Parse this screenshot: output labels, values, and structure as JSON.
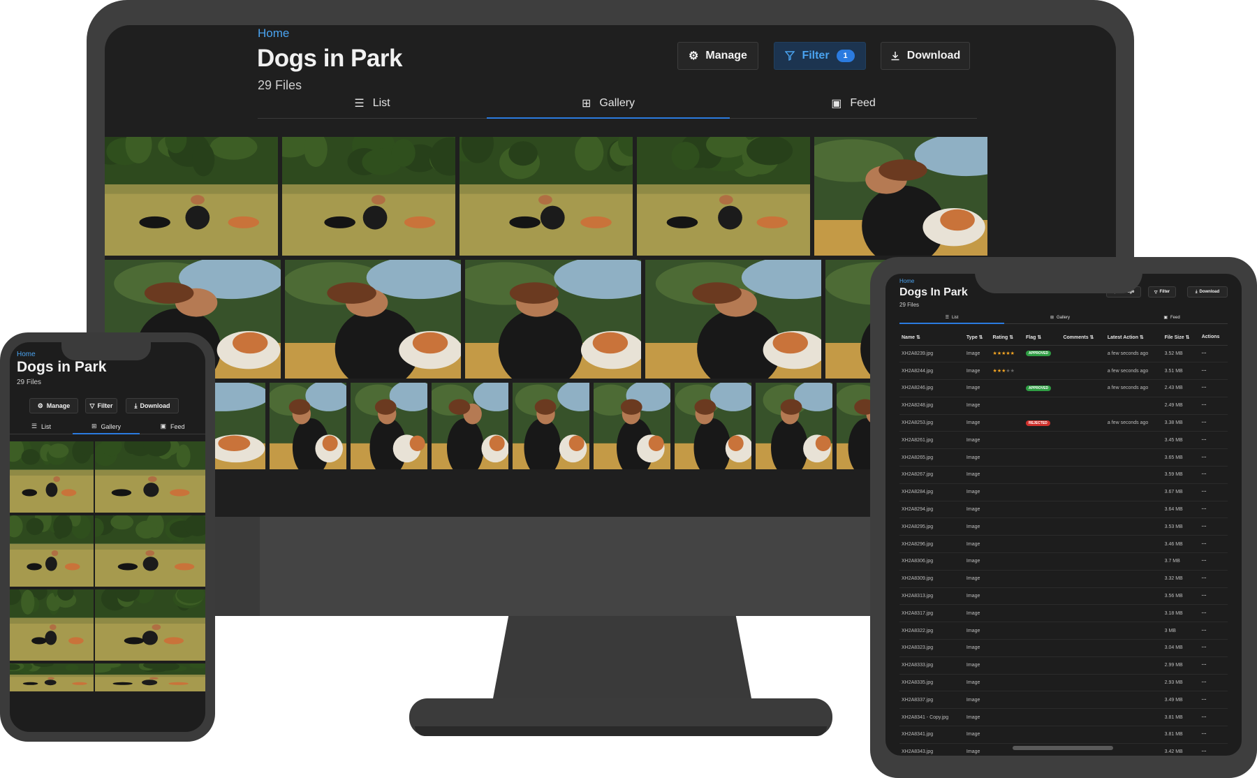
{
  "app": {
    "breadcrumb": "Home",
    "title": "Dogs in Park",
    "tablet_title": "Dogs In Park",
    "file_count": "29 Files"
  },
  "toolbar": {
    "manage_label": "Manage",
    "filter_label": "Filter",
    "filter_count": "1",
    "download_label": "Download"
  },
  "tabs": [
    {
      "label": "List",
      "icon": "list-icon",
      "active": false
    },
    {
      "label": "Gallery",
      "icon": "grid-icon",
      "active": true
    },
    {
      "label": "Feed",
      "icon": "image-icon",
      "active": false
    }
  ],
  "colors": {
    "accent": "#2b7be0",
    "link": "#4aa3f0",
    "background": "#1f1f1f",
    "approved": "#2f9e44",
    "rejected": "#d0312d",
    "star": "#f5a623"
  },
  "table": {
    "columns": [
      "Name ⇅",
      "Type ⇅",
      "Rating ⇅",
      "Flag ⇅",
      "Comments ⇅",
      "Latest Action ⇅",
      "File Size ⇅",
      "Actions"
    ],
    "rows": [
      {
        "name": "XH2A8239.jpg",
        "type": "Image",
        "rating": 5,
        "flag": "APPROVED",
        "action": "a few seconds ago",
        "size": "3.52 MB"
      },
      {
        "name": "XH2A8244.jpg",
        "type": "Image",
        "rating": 3,
        "flag": "",
        "action": "a few seconds ago",
        "size": "3.51 MB"
      },
      {
        "name": "XH2A8246.jpg",
        "type": "Image",
        "rating": 0,
        "flag": "APPROVED",
        "action": "a few seconds ago",
        "size": "2.43 MB"
      },
      {
        "name": "XH2A8248.jpg",
        "type": "Image",
        "rating": 0,
        "flag": "",
        "action": "",
        "size": "2.49 MB"
      },
      {
        "name": "XH2A8253.jpg",
        "type": "Image",
        "rating": 0,
        "flag": "REJECTED",
        "action": "a few seconds ago",
        "size": "3.38 MB"
      },
      {
        "name": "XH2A8261.jpg",
        "type": "Image",
        "rating": 0,
        "flag": "",
        "action": "",
        "size": "3.45 MB"
      },
      {
        "name": "XH2A8265.jpg",
        "type": "Image",
        "rating": 0,
        "flag": "",
        "action": "",
        "size": "3.65 MB"
      },
      {
        "name": "XH2A8267.jpg",
        "type": "Image",
        "rating": 0,
        "flag": "",
        "action": "",
        "size": "3.59 MB"
      },
      {
        "name": "XH2A8284.jpg",
        "type": "Image",
        "rating": 0,
        "flag": "",
        "action": "",
        "size": "3.67 MB"
      },
      {
        "name": "XH2A8294.jpg",
        "type": "Image",
        "rating": 0,
        "flag": "",
        "action": "",
        "size": "3.64 MB"
      },
      {
        "name": "XH2A8295.jpg",
        "type": "Image",
        "rating": 0,
        "flag": "",
        "action": "",
        "size": "3.53 MB"
      },
      {
        "name": "XH2A8296.jpg",
        "type": "Image",
        "rating": 0,
        "flag": "",
        "action": "",
        "size": "3.46 MB"
      },
      {
        "name": "XH2A8306.jpg",
        "type": "Image",
        "rating": 0,
        "flag": "",
        "action": "",
        "size": "3.7 MB"
      },
      {
        "name": "XH2A8309.jpg",
        "type": "Image",
        "rating": 0,
        "flag": "",
        "action": "",
        "size": "3.32 MB"
      },
      {
        "name": "XH2A8313.jpg",
        "type": "Image",
        "rating": 0,
        "flag": "",
        "action": "",
        "size": "3.56 MB"
      },
      {
        "name": "XH2A8317.jpg",
        "type": "Image",
        "rating": 0,
        "flag": "",
        "action": "",
        "size": "3.18 MB"
      },
      {
        "name": "XH2A8322.jpg",
        "type": "Image",
        "rating": 0,
        "flag": "",
        "action": "",
        "size": "3 MB"
      },
      {
        "name": "XH2A8323.jpg",
        "type": "Image",
        "rating": 0,
        "flag": "",
        "action": "",
        "size": "3.04 MB"
      },
      {
        "name": "XH2A8333.jpg",
        "type": "Image",
        "rating": 0,
        "flag": "",
        "action": "",
        "size": "2.99 MB"
      },
      {
        "name": "XH2A8335.jpg",
        "type": "Image",
        "rating": 0,
        "flag": "",
        "action": "",
        "size": "2.93 MB"
      },
      {
        "name": "XH2A8337.jpg",
        "type": "Image",
        "rating": 0,
        "flag": "",
        "action": "",
        "size": "3.49 MB"
      },
      {
        "name": "XH2A8341 - Copy.jpg",
        "type": "Image",
        "rating": 0,
        "flag": "",
        "action": "",
        "size": "3.81 MB"
      },
      {
        "name": "XH2A8341.jpg",
        "type": "Image",
        "rating": 0,
        "flag": "",
        "action": "",
        "size": "3.81 MB"
      },
      {
        "name": "XH2A8343.jpg",
        "type": "Image",
        "rating": 0,
        "flag": "",
        "action": "",
        "size": "3.42 MB"
      }
    ],
    "actions_glyph": "···"
  },
  "icons": {
    "manage": "gear-icon",
    "filter": "funnel-icon",
    "download": "download-icon"
  }
}
